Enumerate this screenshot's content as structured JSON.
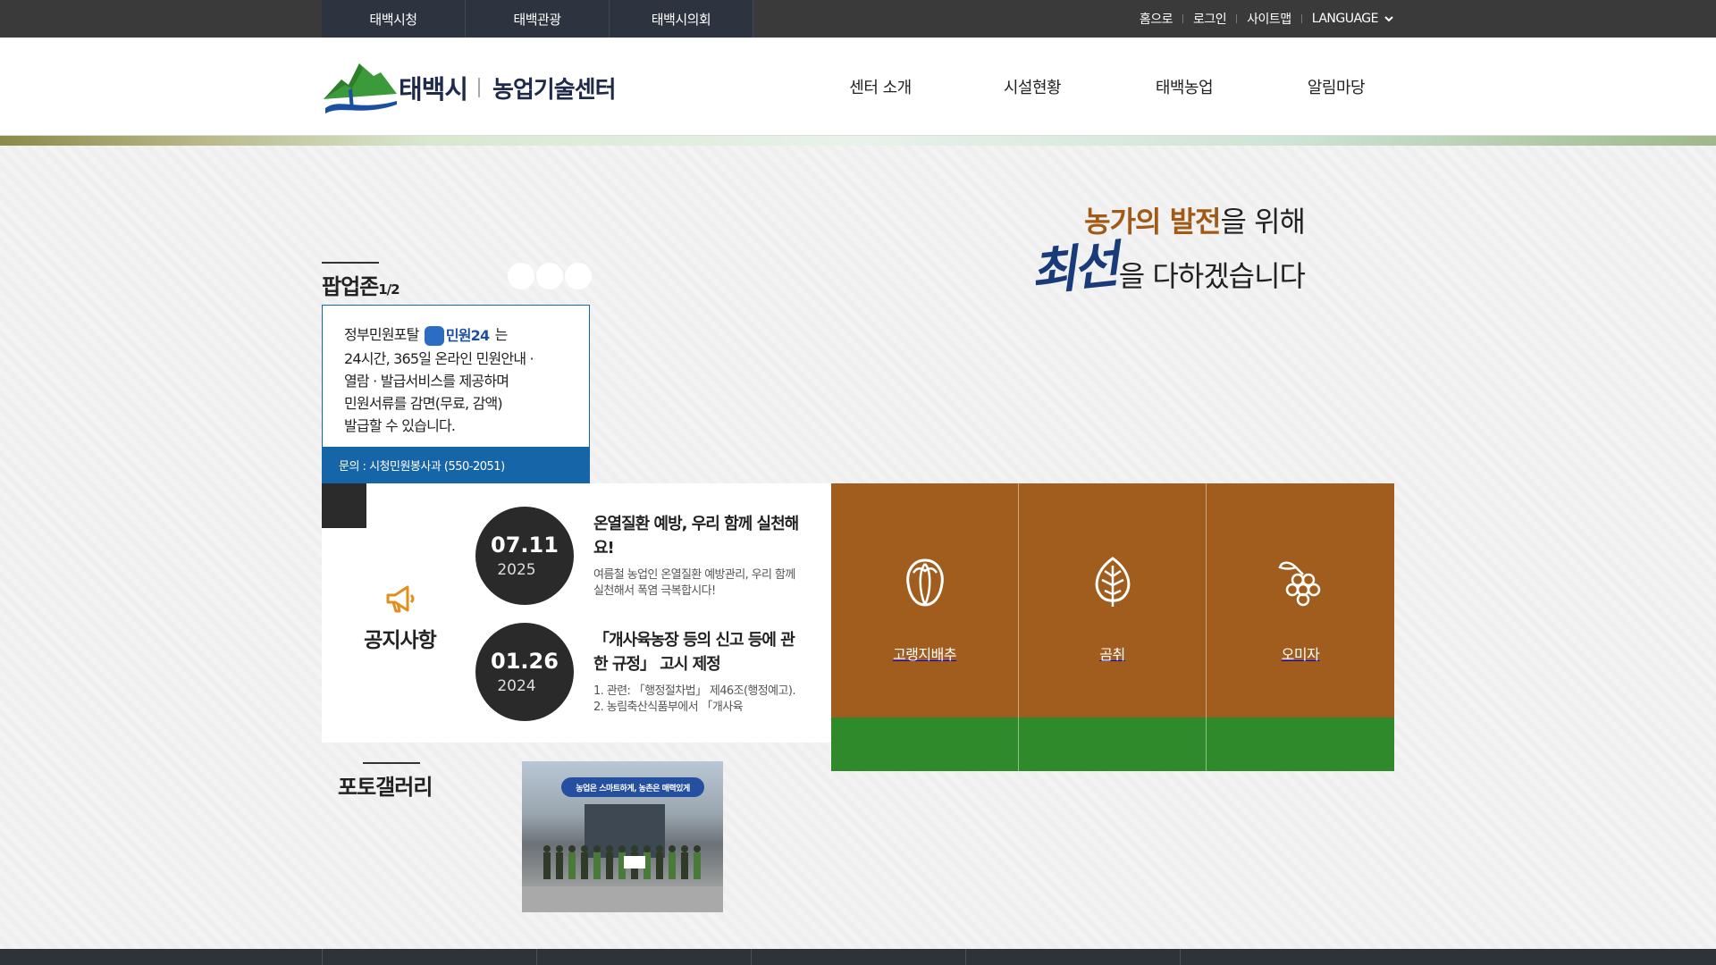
{
  "topbar": {
    "sites": [
      "태백시청",
      "태백관광",
      "태백시의회"
    ],
    "util": {
      "home": "홈으로",
      "login": "로그인",
      "sitemap": "사이트맵",
      "language": "LANGUAGE"
    }
  },
  "header": {
    "logo_city": "태백시",
    "logo_center": "농업기술센터",
    "nav": [
      "센터 소개",
      "시설현황",
      "태백농업",
      "알림마당"
    ]
  },
  "slogan": {
    "highlight": "농가의 발전",
    "line1_rest": "을 위해",
    "brush": "최선",
    "line2_rest": "을 다하겠습니다"
  },
  "popup": {
    "title": "팝업존",
    "count": "1/2",
    "text_before_logo": "정부민원포탈",
    "logo_text": "민원24",
    "text_after_logo": "는",
    "lines": [
      "24시간, 365일 온라인 민원안내 ·",
      "열람 · 발급서비스를 제공하며",
      "민원서류를 감면(무료, 감액)",
      "발급할 수 있습니다."
    ],
    "footer": "문의 : 시청민원봉사과 (550-2051)"
  },
  "notice": {
    "label": "공지사항",
    "items": [
      {
        "date": "07.11",
        "year": "2025",
        "title": "온열질환 예방, 우리 함께 실천해요!",
        "summary": "여름철 농업인 온열질환 예방관리, 우리 함께 실천해서 폭염 극복합시다!"
      },
      {
        "date": "01.26",
        "year": "2024",
        "title": "「개사육농장 등의 신고 등에 관한 규정」 고시 제정",
        "summary": "1. 관련: 「행정절차법」 제46조(행정예고). 2. 농림축산식품부에서 「개사육"
      }
    ]
  },
  "specialties": [
    {
      "name": "고랭지배추",
      "icon": "cabbage-icon"
    },
    {
      "name": "곰취",
      "icon": "leaf-icon"
    },
    {
      "name": "오미자",
      "icon": "berry-icon"
    }
  ],
  "gallery": {
    "title": "포토갤러리",
    "photo_banner": "농업은 스마트하게, 농촌은 매력있게"
  },
  "colors": {
    "topbar": "#3a3a3a",
    "site_tab": "#2d3440",
    "popup_blue": "#1765a9",
    "specialty_brown": "#a05d1e",
    "specialty_green": "#2f8a2c",
    "slogan_highlight": "#a05a16",
    "brush_blue": "#1a3b7a"
  }
}
